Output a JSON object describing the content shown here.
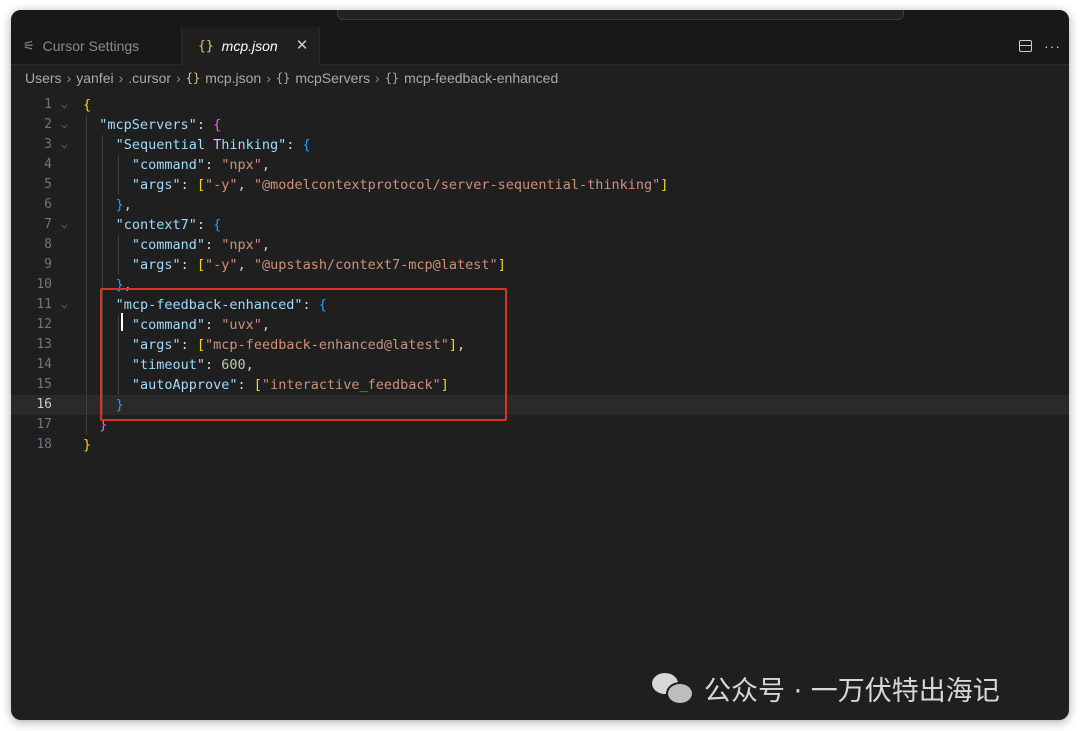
{
  "tabs": [
    {
      "label": "Cursor Settings",
      "icon": "settings-icon",
      "active": false
    },
    {
      "label": "mcp.json",
      "icon": "json-braces-icon",
      "active": true
    }
  ],
  "tab_close_glyph": "✕",
  "breadcrumb": [
    "Users",
    "yanfei",
    ".cursor",
    "mcp.json",
    "mcpServers",
    "mcp-feedback-enhanced"
  ],
  "breadcrumb_icons": {
    "file": "{}",
    "object": "{}"
  },
  "active_line": 16,
  "code_lines": [
    {
      "n": "1",
      "text": "{"
    },
    {
      "n": "2",
      "text": "  \"mcpServers\": {"
    },
    {
      "n": "3",
      "text": "    \"Sequential Thinking\": {"
    },
    {
      "n": "4",
      "text": "      \"command\": \"npx\","
    },
    {
      "n": "5",
      "text": "      \"args\": [\"-y\", \"@modelcontextprotocol/server-sequential-thinking\"]"
    },
    {
      "n": "6",
      "text": "    },"
    },
    {
      "n": "7",
      "text": "    \"context7\": {"
    },
    {
      "n": "8",
      "text": "      \"command\": \"npx\","
    },
    {
      "n": "9",
      "text": "      \"args\": [\"-y\", \"@upstash/context7-mcp@latest\"]"
    },
    {
      "n": "10",
      "text": "    },"
    },
    {
      "n": "11",
      "text": "    \"mcp-feedback-enhanced\": {"
    },
    {
      "n": "12",
      "text": "      \"command\": \"uvx\","
    },
    {
      "n": "13",
      "text": "      \"args\": [\"mcp-feedback-enhanced@latest\"],"
    },
    {
      "n": "14",
      "text": "      \"timeout\": 600,"
    },
    {
      "n": "15",
      "text": "      \"autoApprove\": [\"interactive_feedback\"]"
    },
    {
      "n": "16",
      "text": "    }"
    },
    {
      "n": "17",
      "text": "  }"
    },
    {
      "n": "18",
      "text": "}"
    }
  ],
  "folding_lines": [
    1,
    2,
    3,
    7,
    11
  ],
  "watermark": "公众号 · 一万伏特出海记",
  "colors": {
    "background": "#1f1f1f",
    "json_key": "#9cdcfe",
    "json_string": "#ce9178",
    "json_number": "#b5cea8",
    "bracket_level1": "#ffd700",
    "bracket_level2": "#da70d6",
    "bracket_level3": "#179fff",
    "highlight_box": "#e03127"
  }
}
